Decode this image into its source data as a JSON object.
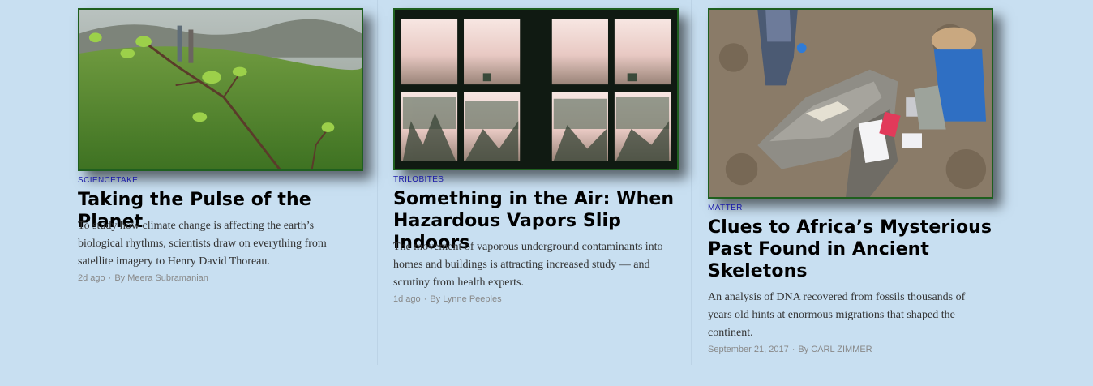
{
  "articles": [
    {
      "kicker": "ScienceTake",
      "headline": "Taking the Pulse of the Planet",
      "summary": "To study how climate change is affecting the earth’s biological rhythms, scientists draw on everything from satellite imagery to Henry David Thoreau.",
      "date": "2d ago",
      "separator": "·",
      "byline": "By Meera Subramanian",
      "image": "budding-branch-photo"
    },
    {
      "kicker": "Trilobites",
      "headline": "Something in the Air: When Hazardous Vapors Slip Indoors",
      "summary": "The movement of vaporous underground contaminants into homes and buildings is attracting increased study — and scrutiny from health experts.",
      "date": "1d ago",
      "separator": "·",
      "byline": "By Lynne Peeples",
      "image": "foggy-window-photo"
    },
    {
      "kicker": "Matter",
      "headline": "Clues to Africa’s Mysterious Past Found in Ancient Skeletons",
      "summary": "An analysis of DNA recovered from fossils thousands of years old hints at enormous migrations that shaped the continent.",
      "date": "September 21, 2017",
      "separator": "·",
      "byline": "By CARL ZIMMER",
      "image": "excavation-rock-photo"
    }
  ],
  "colors": {
    "background": "#c8dff1",
    "kicker": "#1a1aa8",
    "image_border": "#1f5f1f",
    "meta": "#888888"
  }
}
